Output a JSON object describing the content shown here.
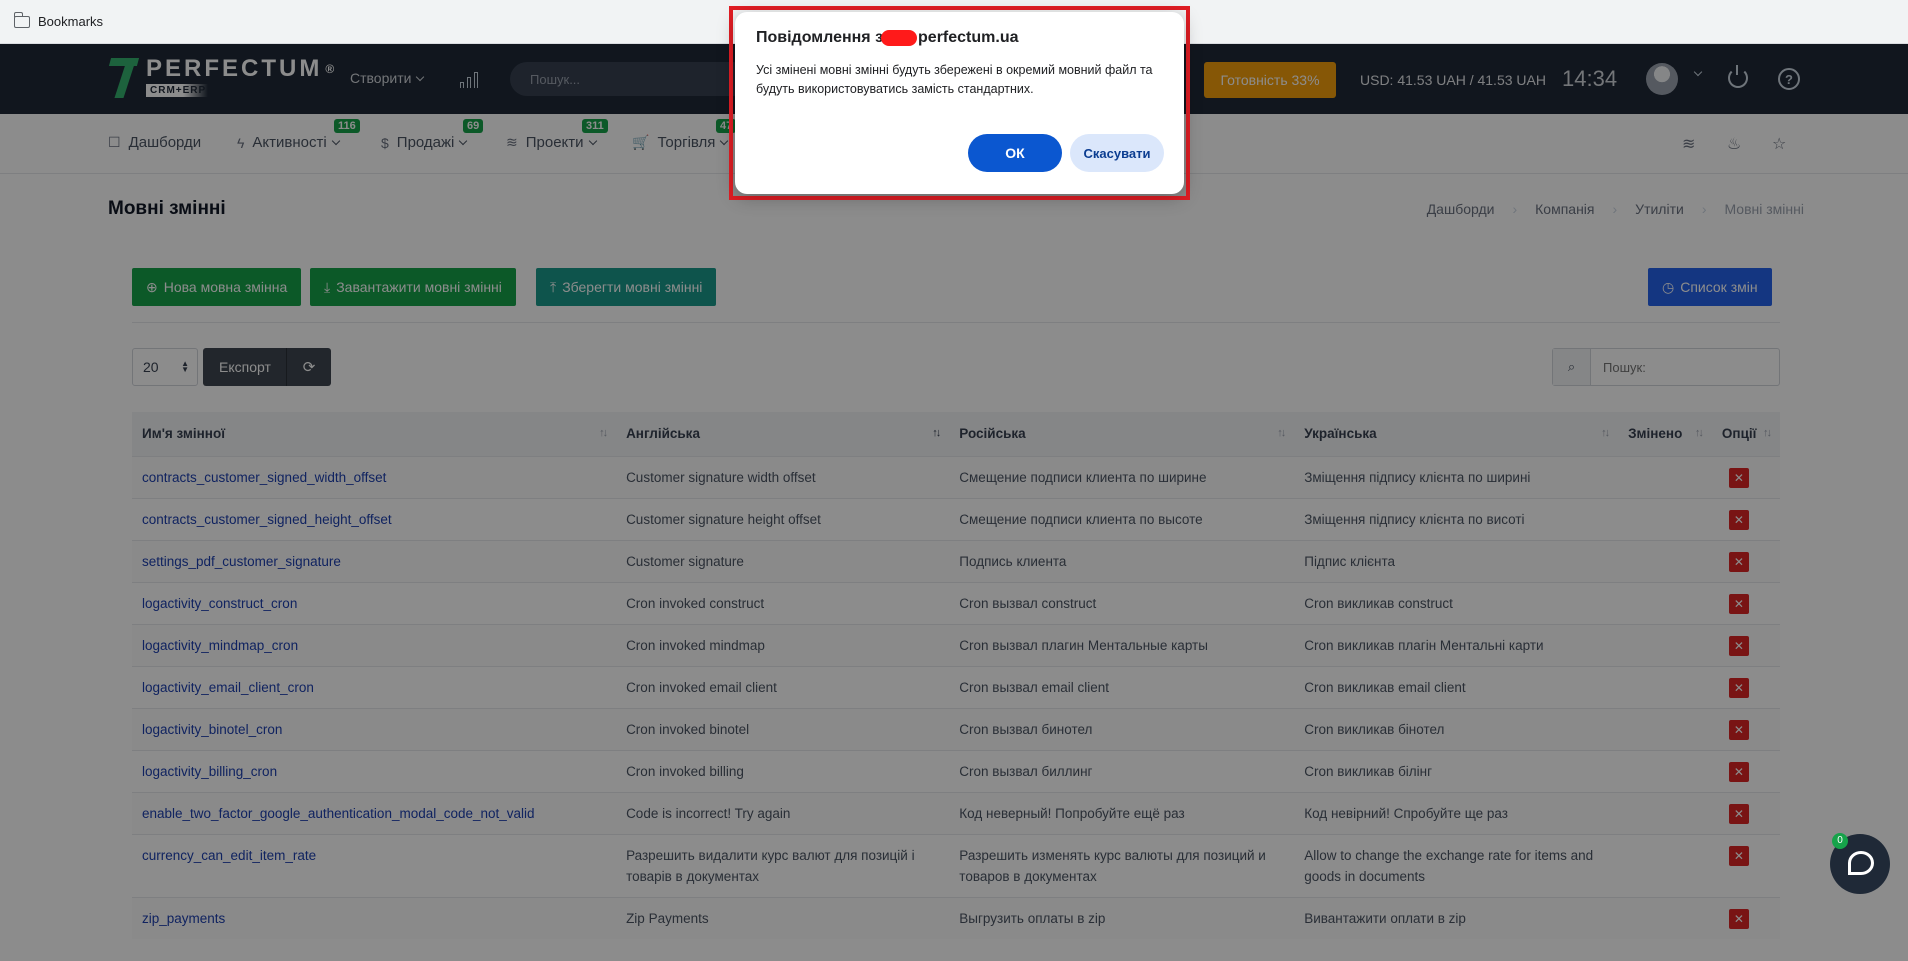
{
  "bookmarks_bar": {
    "label": "Bookmarks",
    "icon": "folder-icon"
  },
  "header": {
    "logo_name": "PERFECTUM",
    "logo_reg": "®",
    "logo_sub": "CRM+ERP",
    "create_label": "Створити",
    "search_placeholder": "Пошук...",
    "readiness": "Готовність 33%",
    "currency": "USD: 41.53 UAH / 41.53 UAH",
    "clock": "14:34"
  },
  "nav": {
    "items": [
      {
        "label": "Дашборди",
        "icon": "☐"
      },
      {
        "label": "Активності",
        "icon": "ϟ",
        "badge": "116"
      },
      {
        "label": "Продажі",
        "icon": "$",
        "badge": "69"
      },
      {
        "label": "Проекти",
        "icon": "≋",
        "badge": "311"
      },
      {
        "label": "Торгівля",
        "icon": "🛒",
        "badge": "47"
      }
    ]
  },
  "page": {
    "title": "Мовні змінні",
    "breadcrumb": [
      "Дашборди",
      "Компанія",
      "Утиліти",
      "Мовні змінні"
    ]
  },
  "toolbar": {
    "new_label": "Нова мовна змінна",
    "upload_label": "Завантажити мовні змінні",
    "save_label": "Зберегти мовні змінні",
    "changes_label": "Список змін"
  },
  "table_controls": {
    "per_page": "20",
    "export_label": "Експорт",
    "search_placeholder": "Пошук:"
  },
  "table": {
    "headers": [
      "Им'я змінної",
      "Англійська",
      "Російська",
      "Українська",
      "Змінено",
      "Опції"
    ],
    "rows": [
      [
        "contracts_customer_signed_width_offset",
        "Customer signature width offset",
        "Смещение подписи клиента по ширине",
        "Зміщення підпису клієнта по ширині",
        ""
      ],
      [
        "contracts_customer_signed_height_offset",
        "Customer signature height offset",
        "Смещение подписи клиента по высоте",
        "Зміщення підпису клієнта по висоті",
        ""
      ],
      [
        "settings_pdf_customer_signature",
        "Customer signature",
        "Подпись клиента",
        "Підпис клієнта",
        ""
      ],
      [
        "logactivity_construct_cron",
        "Cron invoked construct",
        "Cron вызвал construct",
        "Cron викликав construct",
        ""
      ],
      [
        "logactivity_mindmap_cron",
        "Cron invoked mindmap",
        "Cron вызвал плагин Ментальные карты",
        "Cron викликав плагін Ментальні карти",
        ""
      ],
      [
        "logactivity_email_client_cron",
        "Cron invoked email client",
        "Cron вызвал email client",
        "Cron викликав email client",
        ""
      ],
      [
        "logactivity_binotel_cron",
        "Cron invoked binotel",
        "Cron вызвал бинотел",
        "Cron викликав бінотел",
        ""
      ],
      [
        "logactivity_billing_cron",
        "Cron invoked billing",
        "Cron вызвал биллинг",
        "Cron викликав білінг",
        ""
      ],
      [
        "enable_two_factor_google_authentication_modal_code_not_valid",
        "Code is incorrect! Try again",
        "Код неверный! Попробуйте ещё раз",
        "Код невірний! Спробуйте ще раз",
        ""
      ],
      [
        "currency_can_edit_item_rate",
        "Разрешить видалити курс валют для позицій і товарів в документах",
        "Разрешить изменять курс валюты для позиций и товаров в документах",
        "Allow to change the exchange rate for items and goods in documents",
        ""
      ],
      [
        "zip_payments",
        "Zip Payments",
        "Выгрузить оплаты в zip",
        "Вивантажити оплати в zip",
        ""
      ]
    ],
    "delete_glyph": "✕"
  },
  "chat": {
    "badge": "0"
  },
  "dialog": {
    "title_prefix": "Повідомлення з",
    "title_suffix": "perfectum.ua",
    "message": "Усі змінені мовні змінні будуть збережені в окремий мовний файл та будуть використовуватись замість стандартних.",
    "ok_label": "ОК",
    "cancel_label": "Скасувати"
  },
  "colors": {
    "brand_green": "#35b36f",
    "header_bg": "#1f2937",
    "readiness": "#f59e0b",
    "dialog_highlight": "#e11d24",
    "ok_button": "#0b57d0"
  }
}
